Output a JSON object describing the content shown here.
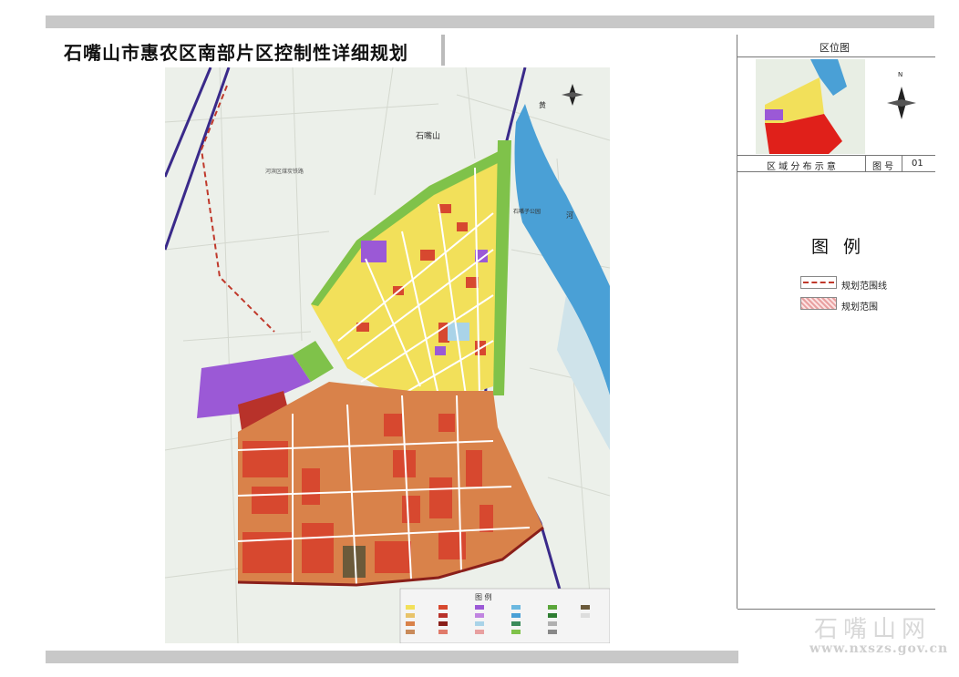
{
  "title": "石嘴山市惠农区南部片区控制性详细规划",
  "side_panel": {
    "location_map_title": "区位图",
    "location_caption": "区 域 分 布 示 意",
    "sheet_label": "图 号",
    "sheet_number": "01",
    "north_label": "N"
  },
  "legend": {
    "title": "图 例",
    "items": [
      {
        "label": "规划范围线",
        "color": "#c0392b"
      },
      {
        "label": "规划范围",
        "color": "#e8a0a0"
      }
    ]
  },
  "map": {
    "mini_legend_title": "图  例",
    "labels": {
      "city": "石嘴山",
      "park": "石嘴子公园",
      "river_1": "黄",
      "river_2": "河",
      "district": "河滨区煤炭铁路"
    }
  },
  "watermark": {
    "text": "石嘴山网",
    "url": "www.nxszs.gov.cn"
  },
  "colors": {
    "residential": "#f2e05a",
    "commercial": "#d7482f",
    "industrial": "#d9824a",
    "education": "#9b59d6",
    "green": "#7fc24a",
    "water": "#4aa0d6"
  }
}
